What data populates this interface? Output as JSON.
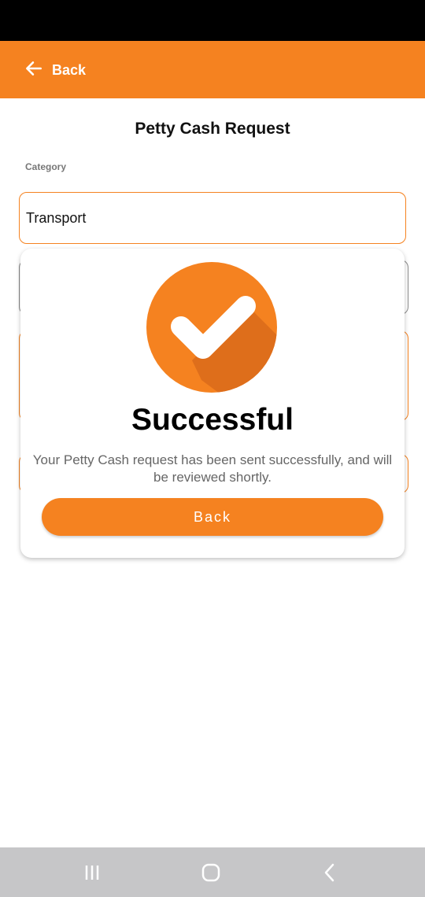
{
  "header": {
    "back_label": "Back",
    "icon": "arrow-left-icon",
    "accent_color": "#f58220"
  },
  "form": {
    "title": "Petty Cash Request",
    "category_label": "Category",
    "category_value": "Transport"
  },
  "modal": {
    "icon": "check-circle-icon",
    "title": "Successful",
    "message": "Your Petty Cash request has been sent successfully, and will be reviewed shortly.",
    "button_label": "Back"
  },
  "nav": {
    "recent_icon": "recent-apps-icon",
    "home_icon": "home-icon",
    "back_icon": "nav-back-icon"
  }
}
